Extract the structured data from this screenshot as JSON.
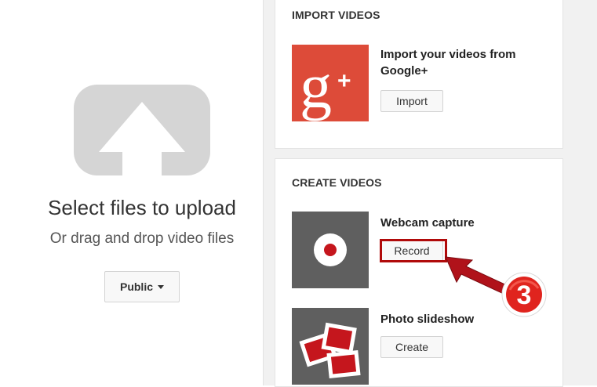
{
  "upload": {
    "title": "Select files to upload",
    "subtitle": "Or drag and drop video files",
    "privacy_label": "Public",
    "icon": "upload-arrow-icon"
  },
  "import_card": {
    "heading": "IMPORT VIDEOS",
    "item": {
      "title": "Import your videos from Google+",
      "button_label": "Import",
      "icon": "google-plus-icon",
      "color": "#dd4b39"
    }
  },
  "create_card": {
    "heading": "CREATE VIDEOS",
    "items": [
      {
        "title": "Webcam capture",
        "button_label": "Record",
        "icon": "webcam-record-icon"
      },
      {
        "title": "Photo slideshow",
        "button_label": "Create",
        "icon": "photo-slideshow-icon"
      }
    ]
  },
  "annotation": {
    "step_number": "3",
    "color": "#c0151c"
  },
  "colors": {
    "panel_bg": "#f1f1f1",
    "thumb_dark": "#5f5f5f",
    "upload_icon": "#d5d5d5"
  }
}
